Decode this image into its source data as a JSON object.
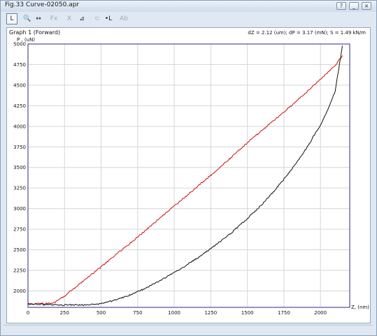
{
  "window": {
    "title": "Fig.33  Curve-02050.apr",
    "buttons": {
      "help": "?",
      "minimize": "_",
      "close": "×"
    }
  },
  "toolbar": {
    "tools": [
      {
        "name": "l-tool",
        "label": "L",
        "state": "active"
      },
      {
        "name": "zoom-tool",
        "label": "🔍",
        "state": "normal"
      },
      {
        "name": "pan-tool",
        "label": "↔",
        "state": "normal"
      },
      {
        "name": "fit-tool",
        "label": "Fx",
        "state": "dim"
      },
      {
        "name": "reset-tool",
        "label": "X",
        "state": "dim"
      },
      {
        "name": "slope-tool",
        "label": "⊿",
        "state": "normal"
      },
      {
        "name": "clip-tool",
        "label": "⊂",
        "state": "dim"
      },
      {
        "name": "marker-tool",
        "label": "•L",
        "state": "normal"
      },
      {
        "name": "text-tool",
        "label": "Ab",
        "state": "dim"
      }
    ]
  },
  "graph": {
    "title": "Graph 1 (Forward)",
    "info": "dZ = 2.12 (um); dP = 3.17 (mN); S = 1.49 kN/m"
  },
  "chart_data": {
    "type": "line",
    "ylabel": "P , (uN)",
    "xlabel": "Z, (nm)",
    "xlim": [
      0,
      2200
    ],
    "ylim": [
      1800,
      5000
    ],
    "x_ticks": [
      0,
      250,
      500,
      750,
      1000,
      1250,
      1500,
      1750,
      2000
    ],
    "y_ticks": [
      2000,
      2250,
      2500,
      2750,
      3000,
      3250,
      3500,
      3750,
      4000,
      4250,
      4500,
      4750,
      5000
    ],
    "grid": true,
    "colors": {
      "loading": "#cc1111",
      "unloading": "#111111",
      "frame": "#2a2a8a"
    },
    "series": [
      {
        "color": "#cc1111",
        "x": [
          0,
          100,
          150,
          180,
          200,
          250,
          300,
          400,
          500,
          600,
          700,
          800,
          900,
          1000,
          1100,
          1200,
          1300,
          1400,
          1500,
          1600,
          1700,
          1800,
          1900,
          2000,
          2100,
          2150
        ],
        "y": [
          1840,
          1845,
          1850,
          1860,
          1880,
          1940,
          2010,
          2150,
          2290,
          2440,
          2580,
          2730,
          2880,
          3030,
          3180,
          3330,
          3480,
          3640,
          3800,
          3950,
          4100,
          4250,
          4410,
          4570,
          4740,
          4860
        ]
      },
      {
        "color": "#111111",
        "x": [
          0,
          100,
          200,
          300,
          400,
          500,
          600,
          700,
          800,
          900,
          1000,
          1100,
          1200,
          1300,
          1400,
          1500,
          1600,
          1700,
          1800,
          1900,
          2000,
          2050,
          2100,
          2150
        ],
        "y": [
          1840,
          1835,
          1830,
          1828,
          1830,
          1845,
          1890,
          1950,
          2030,
          2120,
          2220,
          2330,
          2450,
          2580,
          2720,
          2880,
          3050,
          3250,
          3470,
          3720,
          4020,
          4200,
          4420,
          4980
        ]
      }
    ]
  }
}
